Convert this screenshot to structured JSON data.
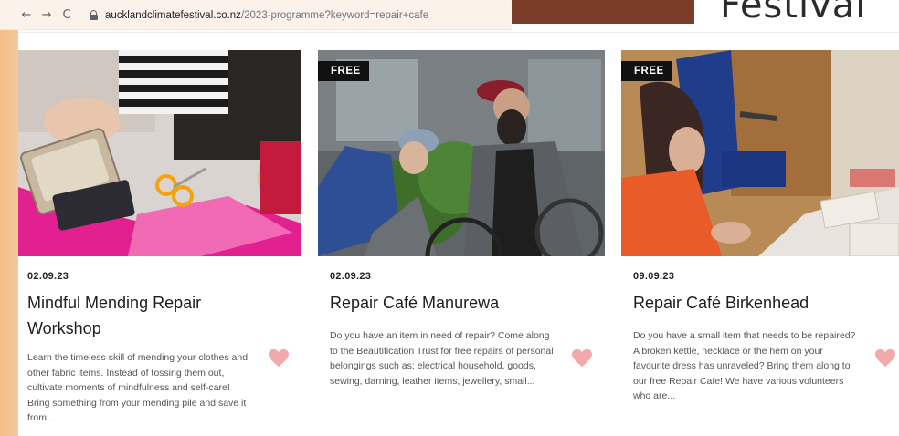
{
  "browser": {
    "back_glyph": "←",
    "forward_glyph": "→",
    "reload_glyph": "C",
    "url_domain": "aucklandclimatefestival.co.nz",
    "url_path": "/2023-programme?keyword=repair+cafe"
  },
  "header": {
    "logo_text": "Festival",
    "brand_color": "#7b3d28"
  },
  "colors": {
    "heart": "#f2a9a9",
    "badge_bg": "#111111",
    "left_strip": "#f4bd86"
  },
  "events": [
    {
      "date": "02.09.23",
      "title": "Mindful Mending Repair Workshop",
      "description": "Learn the timeless skill of mending your clothes and other fabric items. Instead of tossing them out, cultivate moments of mindfulness and self-care! Bring something from your mending pile and save it from...",
      "badge": "",
      "favorite_icon": "heart-icon"
    },
    {
      "date": "02.09.23",
      "title": "Repair Café Manurewa",
      "description": "Do you have an item in need of repair? Come along to the Beautification Trust for free repairs of personal belongings such as; electrical household, goods, sewing, darning, leather items, jewellery, small...",
      "badge": "FREE",
      "favorite_icon": "heart-icon"
    },
    {
      "date": "09.09.23",
      "title": "Repair Café Birkenhead",
      "description": "Do you have a small item that needs to be repaired? A broken kettle, necklace or the hem on your favourite dress has unraveled? Bring them along to our free Repair Cafe! We have various volunteers who are...",
      "badge": "FREE",
      "favorite_icon": "heart-icon"
    }
  ]
}
